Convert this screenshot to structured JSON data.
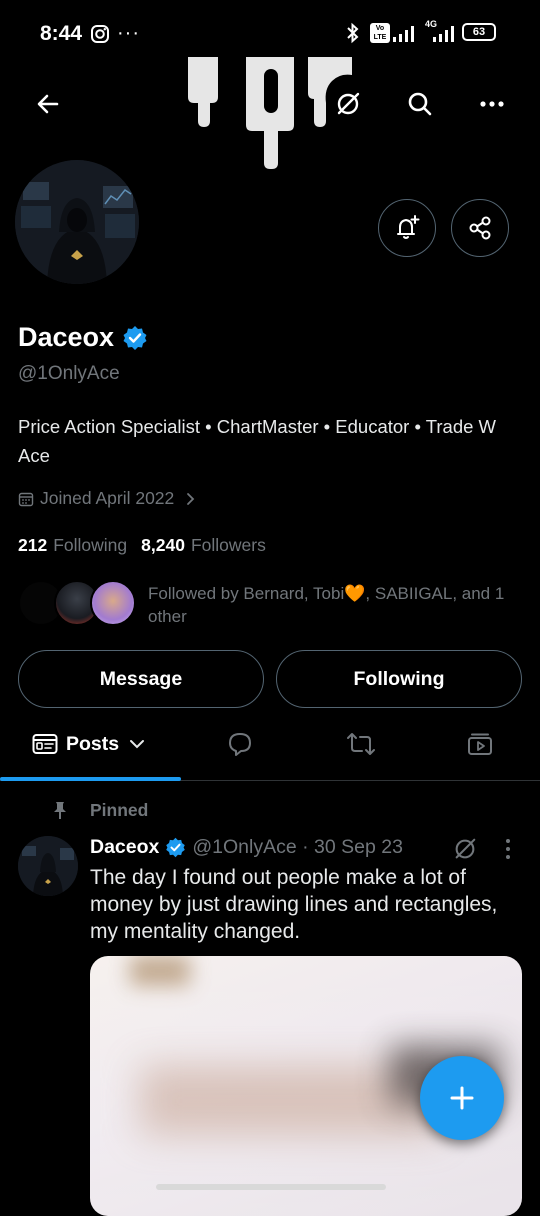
{
  "status_bar": {
    "time": "8:44",
    "battery": "63",
    "network": "4G",
    "volte": "Vo LTE"
  },
  "header": {
    "back_icon": "arrow-left-icon",
    "grok_icon": "grok-icon",
    "search_icon": "search-icon",
    "more_icon": "more-icon"
  },
  "profile": {
    "name": "Daceox",
    "handle": "@1OnlyAce",
    "bio": "Price Action Specialist  • ChartMaster • Educator • Trade W Ace",
    "joined": "Joined April 2022",
    "following_count": "212",
    "following_label": "Following",
    "followers_count": "8,240",
    "followers_label": "Followers",
    "followed_by": "Followed by Bernard, Tobi🧡, SABIIGAL, and 1 other"
  },
  "actions": {
    "message_label": "Message",
    "following_label": "Following"
  },
  "tabs": {
    "posts_label": "Posts"
  },
  "post": {
    "pinned_label": "Pinned",
    "author": "Daceox",
    "meta": "@1OnlyAce · 30 Sep 23",
    "text": "The day I found out people make a lot of money by just drawing lines and rectangles, my mentality changed."
  },
  "colors": {
    "accent": "#1d9bf0",
    "background": "#000000",
    "muted": "#71767b",
    "border": "#536471"
  }
}
